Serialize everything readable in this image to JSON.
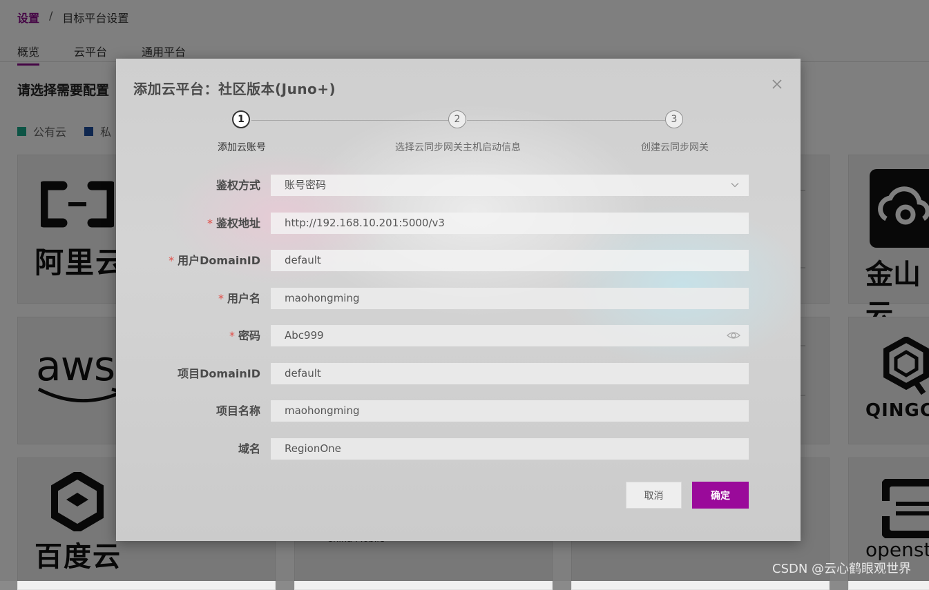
{
  "breadcrumb": {
    "root": "设置",
    "separator": "/",
    "current": "目标平台设置"
  },
  "tabs": [
    {
      "label": "概览",
      "active": true
    },
    {
      "label": "云平台",
      "active": false
    },
    {
      "label": "通用平台",
      "active": false
    }
  ],
  "section_title": "请选择需要配置",
  "legend": [
    {
      "label": "公有云",
      "color": "#1aa88a"
    },
    {
      "label": "私",
      "color": "#1f4e9e"
    }
  ],
  "logos": {
    "aliyun": "阿里云",
    "aws": "aws",
    "baidu": "百度云",
    "china_mobile": "China Mobile",
    "kingsoft": "金山云",
    "qingcloud": "QINGCLO",
    "openstack": "openstack"
  },
  "modal": {
    "title": "添加云平台：社区版本(Juno+)",
    "close_icon": "close-icon",
    "steps": [
      {
        "number": "1",
        "label": "添加云账号",
        "active": true
      },
      {
        "number": "2",
        "label": "选择云同步网关主机启动信息",
        "active": false
      },
      {
        "number": "3",
        "label": "创建云同步网关",
        "active": false
      }
    ],
    "required_mark": "*",
    "fields": {
      "auth_method": {
        "label": "鉴权方式",
        "value": "账号密码"
      },
      "auth_url": {
        "label": "鉴权地址",
        "value": "http://192.168.10.201:5000/v3"
      },
      "user_domain": {
        "label": "用户DomainID",
        "value": "default"
      },
      "username": {
        "label": "用户名",
        "value": "maohongming"
      },
      "password": {
        "label": "密码",
        "value": "Abc999"
      },
      "project_domain": {
        "label": "项目DomainID",
        "value": "default"
      },
      "project_name": {
        "label": "项目名称",
        "value": "maohongming"
      },
      "region": {
        "label": "域名",
        "value": "RegionOne"
      }
    },
    "buttons": {
      "cancel": "取消",
      "confirm": "确定"
    }
  },
  "colors": {
    "accent": "#8b0a8b",
    "confirm_button": "#9a0a9a",
    "required": "#e0504a"
  },
  "watermark": "CSDN @云心鹤眼观世界"
}
